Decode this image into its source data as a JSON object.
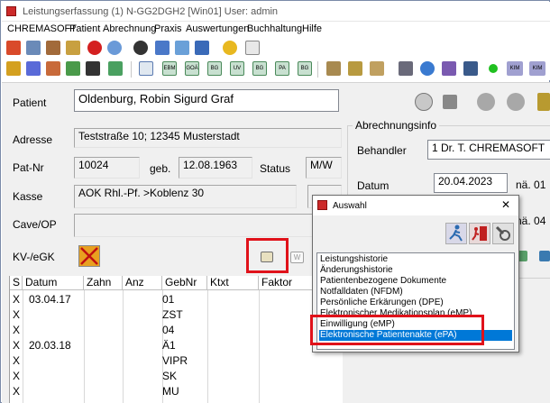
{
  "window": {
    "title": "Leistungserfassung (1) N-GG2DGH2 [Win01] User: admin"
  },
  "menu": [
    "CHREMASOFT",
    "Patient",
    "Abrechnung",
    "Praxis",
    "Auswertungen",
    "Buchhaltung",
    "Hilfe"
  ],
  "toolbar2_labels": [
    "EBM",
    "GOÄ",
    "BG",
    "UV",
    "BG",
    "PA",
    "BG"
  ],
  "patient": {
    "label_patient": "Patient",
    "name": "Oldenburg, Robin Sigurd Graf",
    "label_adresse": "Adresse",
    "adresse": "Teststraße 10; 12345 Musterstadt",
    "label_patnr": "Pat-Nr",
    "patnr": "10024",
    "label_geb": "geb.",
    "geb": "12.08.1963",
    "label_status": "Status",
    "status": "M/W",
    "label_kasse": "Kasse",
    "kasse": "AOK Rhl.-Pf. >Koblenz 30",
    "label_cave": "Cave/OP",
    "label_kv": "KV-/eGK"
  },
  "abrechnung": {
    "group_title": "Abrechnungsinfo",
    "label_behandler": "Behandler",
    "behandler": "1 Dr. T. CHREMASOFT",
    "label_datum": "Datum",
    "datum": "20.04.2023",
    "naechst_1": "nä. 01",
    "naechst_2": "nä. 04"
  },
  "table": {
    "headers": [
      "S",
      "Datum",
      "Zahn",
      "Anz",
      "GebNr",
      "Ktxt",
      "Faktor"
    ],
    "rows": [
      {
        "s": "X",
        "datum": "03.04.17",
        "gebnr": "01"
      },
      {
        "s": "X",
        "datum": "",
        "gebnr": "ZST"
      },
      {
        "s": "X",
        "datum": "",
        "gebnr": "04"
      },
      {
        "s": "X",
        "datum": "20.03.18",
        "gebnr": "Ä1"
      },
      {
        "s": "X",
        "datum": "",
        "gebnr": "VIPR"
      },
      {
        "s": "X",
        "datum": "",
        "gebnr": "SK"
      },
      {
        "s": "X",
        "datum": "",
        "gebnr": "MU"
      }
    ]
  },
  "dialog": {
    "title": "Auswahl",
    "close": "✕",
    "items": [
      "Leistungshistorie",
      "Änderungshistorie",
      "Patientenbezogene Dokumente",
      "Notfalldaten (NFDM)",
      "Persönliche Erkärungen (DPE)",
      "Elektronischer Medikationsplan (eMP)",
      "Einwilligung (eMP)",
      "Elektronische Patientenakte (ePA)"
    ],
    "selected_index": 7
  },
  "colors": {
    "accent": "#0078d7",
    "highlight": "#e0121a"
  }
}
